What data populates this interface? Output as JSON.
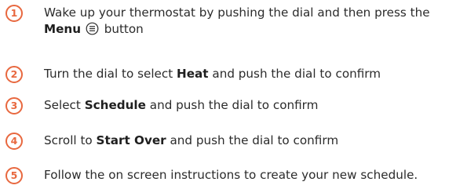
{
  "steps": [
    {
      "number": "1",
      "line1": "Wake up your thermostat by pushing the dial and then press the",
      "bold": "Menu",
      "after": "button",
      "icon": "menu-icon"
    },
    {
      "number": "2",
      "before": "Turn the dial to select",
      "bold": "Heat",
      "after": "and push the dial to confirm"
    },
    {
      "number": "3",
      "before": "Select",
      "bold": "Schedule",
      "after": "and push the dial to confirm"
    },
    {
      "number": "4",
      "before": "Scroll to",
      "bold": "Start Over",
      "after": "and push the dial to confirm"
    },
    {
      "number": "5",
      "text": "Follow the on screen instructions to create your new schedule."
    }
  ],
  "colors": {
    "accent": "#e8683f",
    "text": "#2b2b2b"
  }
}
